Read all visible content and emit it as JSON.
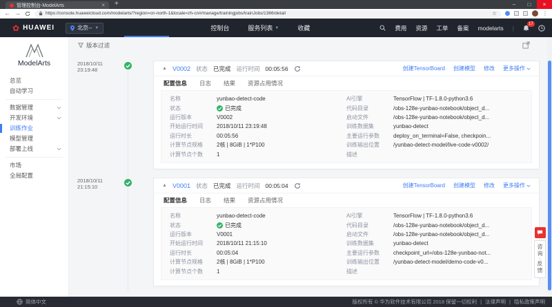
{
  "colors": {
    "accent": "#3d7cf4",
    "success": "#34b368",
    "danger": "#e8322e",
    "header_bg": "#20242c",
    "footer_bg": "#282b33"
  },
  "browser": {
    "tab_title": "管理控制台-ModelArts",
    "url": "https://console.huaweicloud.com/modelarts/?region=cn-north-1&locale=zh-cn#/manage/trainingjobs/trainJobs/1366/detail"
  },
  "console_header": {
    "brand": "HUAWEI",
    "region": "北京--",
    "nav": [
      "控制台",
      "服务列表",
      "收藏"
    ],
    "right_nav": [
      "费用",
      "资源",
      "工单",
      "备案",
      "modelarts"
    ],
    "notification_count": "17"
  },
  "sidebar": {
    "product": "ModelArts",
    "items": [
      {
        "label": "总览",
        "chevron": false,
        "active": false,
        "divider_after": false
      },
      {
        "label": "自动学习",
        "chevron": false,
        "active": false,
        "divider_after": true
      },
      {
        "label": "数据管理",
        "chevron": true,
        "active": false,
        "divider_after": false
      },
      {
        "label": "开发环境",
        "chevron": true,
        "active": false,
        "divider_after": false
      },
      {
        "label": "训练作业",
        "chevron": false,
        "active": true,
        "divider_after": false
      },
      {
        "label": "模型管理",
        "chevron": false,
        "active": false,
        "divider_after": false
      },
      {
        "label": "部署上线",
        "chevron": true,
        "active": false,
        "divider_after": true
      },
      {
        "label": "市场",
        "chevron": false,
        "active": false,
        "divider_after": false
      },
      {
        "label": "全局配置",
        "chevron": false,
        "active": false,
        "divider_after": false
      }
    ]
  },
  "content": {
    "filter_label": "版本过滤"
  },
  "cards": [
    {
      "version": "V0002",
      "timeline_date": "2018/10/11",
      "timeline_time": "23:19:48",
      "status_label": "状态",
      "status": "已完成",
      "runtime_label": "运行时间",
      "runtime": "00:05:56",
      "actions": [
        "创建TensorBoard",
        "创建模型",
        "修改",
        "更多操作"
      ],
      "tabs": [
        "配置信息",
        "日志",
        "结果",
        "资源占用情况"
      ],
      "left": [
        {
          "label": "名称",
          "value": "yunbao-detect-code"
        },
        {
          "label": "状态",
          "value": "已完成",
          "icon": "check"
        },
        {
          "label": "运行版本",
          "value": "V0002"
        },
        {
          "label": "开始运行时间",
          "value": "2018/10/11 23:19:48"
        },
        {
          "label": "运行时长",
          "value": "00:05:56"
        },
        {
          "label": "计算节点规格",
          "value": "2核 | 8GiB | 1*P100"
        },
        {
          "label": "计算节点个数",
          "value": "1"
        }
      ],
      "right": [
        {
          "label": "AI引擎",
          "value": "TensorFlow | TF-1.8.0-python3.6"
        },
        {
          "label": "代码目录",
          "value": "/obs-128e-yunbao-notebook/object_d..."
        },
        {
          "label": "启动文件",
          "value": "/obs-128e-yunbao-notebook/object_d..."
        },
        {
          "label": "训练数据集",
          "value": "yunbao-detect"
        },
        {
          "label": "主要运行参数",
          "value": "deploy_on_terminal=False, checkpoin..."
        },
        {
          "label": "训练输出位置",
          "value": "/yunbao-detect-model/live-code-v0002/"
        },
        {
          "label": "描述",
          "value": ""
        }
      ]
    },
    {
      "version": "V0001",
      "timeline_date": "2018/10/11",
      "timeline_time": "21:15:10",
      "status_label": "状态",
      "status": "已完成",
      "runtime_label": "运行时间",
      "runtime": "00:05:04",
      "actions": [
        "创建TensorBoard",
        "创建模型",
        "修改",
        "更多操作"
      ],
      "tabs": [
        "配置信息",
        "日志",
        "结果",
        "资源占用情况"
      ],
      "left": [
        {
          "label": "名称",
          "value": "yunbao-detect-code"
        },
        {
          "label": "状态",
          "value": "已完成",
          "icon": "check"
        },
        {
          "label": "运行版本",
          "value": "V0001"
        },
        {
          "label": "开始运行时间",
          "value": "2018/10/11 21:15:10"
        },
        {
          "label": "运行时长",
          "value": "00:05:04"
        },
        {
          "label": "计算节点规格",
          "value": "2核 | 8GiB | 1*P100"
        },
        {
          "label": "计算节点个数",
          "value": "1"
        }
      ],
      "right": [
        {
          "label": "AI引擎",
          "value": "TensorFlow | TF-1.8.0-python3.6"
        },
        {
          "label": "代码目录",
          "value": "/obs-128e-yunbao-notebook/object_d..."
        },
        {
          "label": "启动文件",
          "value": "/obs-128e-yunbao-notebook/object_d..."
        },
        {
          "label": "训练数据集",
          "value": "yunbao-detect"
        },
        {
          "label": "主要运行参数",
          "value": "checkpoint_url=/obs-128e-yunbao-not..."
        },
        {
          "label": "训练输出位置",
          "value": "/yunbao-detect-model/demo-code-v0..."
        },
        {
          "label": "描述",
          "value": ""
        }
      ]
    }
  ],
  "feedback": {
    "label": "咨询·反馈"
  },
  "footer": {
    "language": "简体中文",
    "copyright": "版权所有 © 华为软件技术有限公司 2018 保留一切权利",
    "links": [
      "法律声明",
      "隐私政策声明"
    ]
  }
}
